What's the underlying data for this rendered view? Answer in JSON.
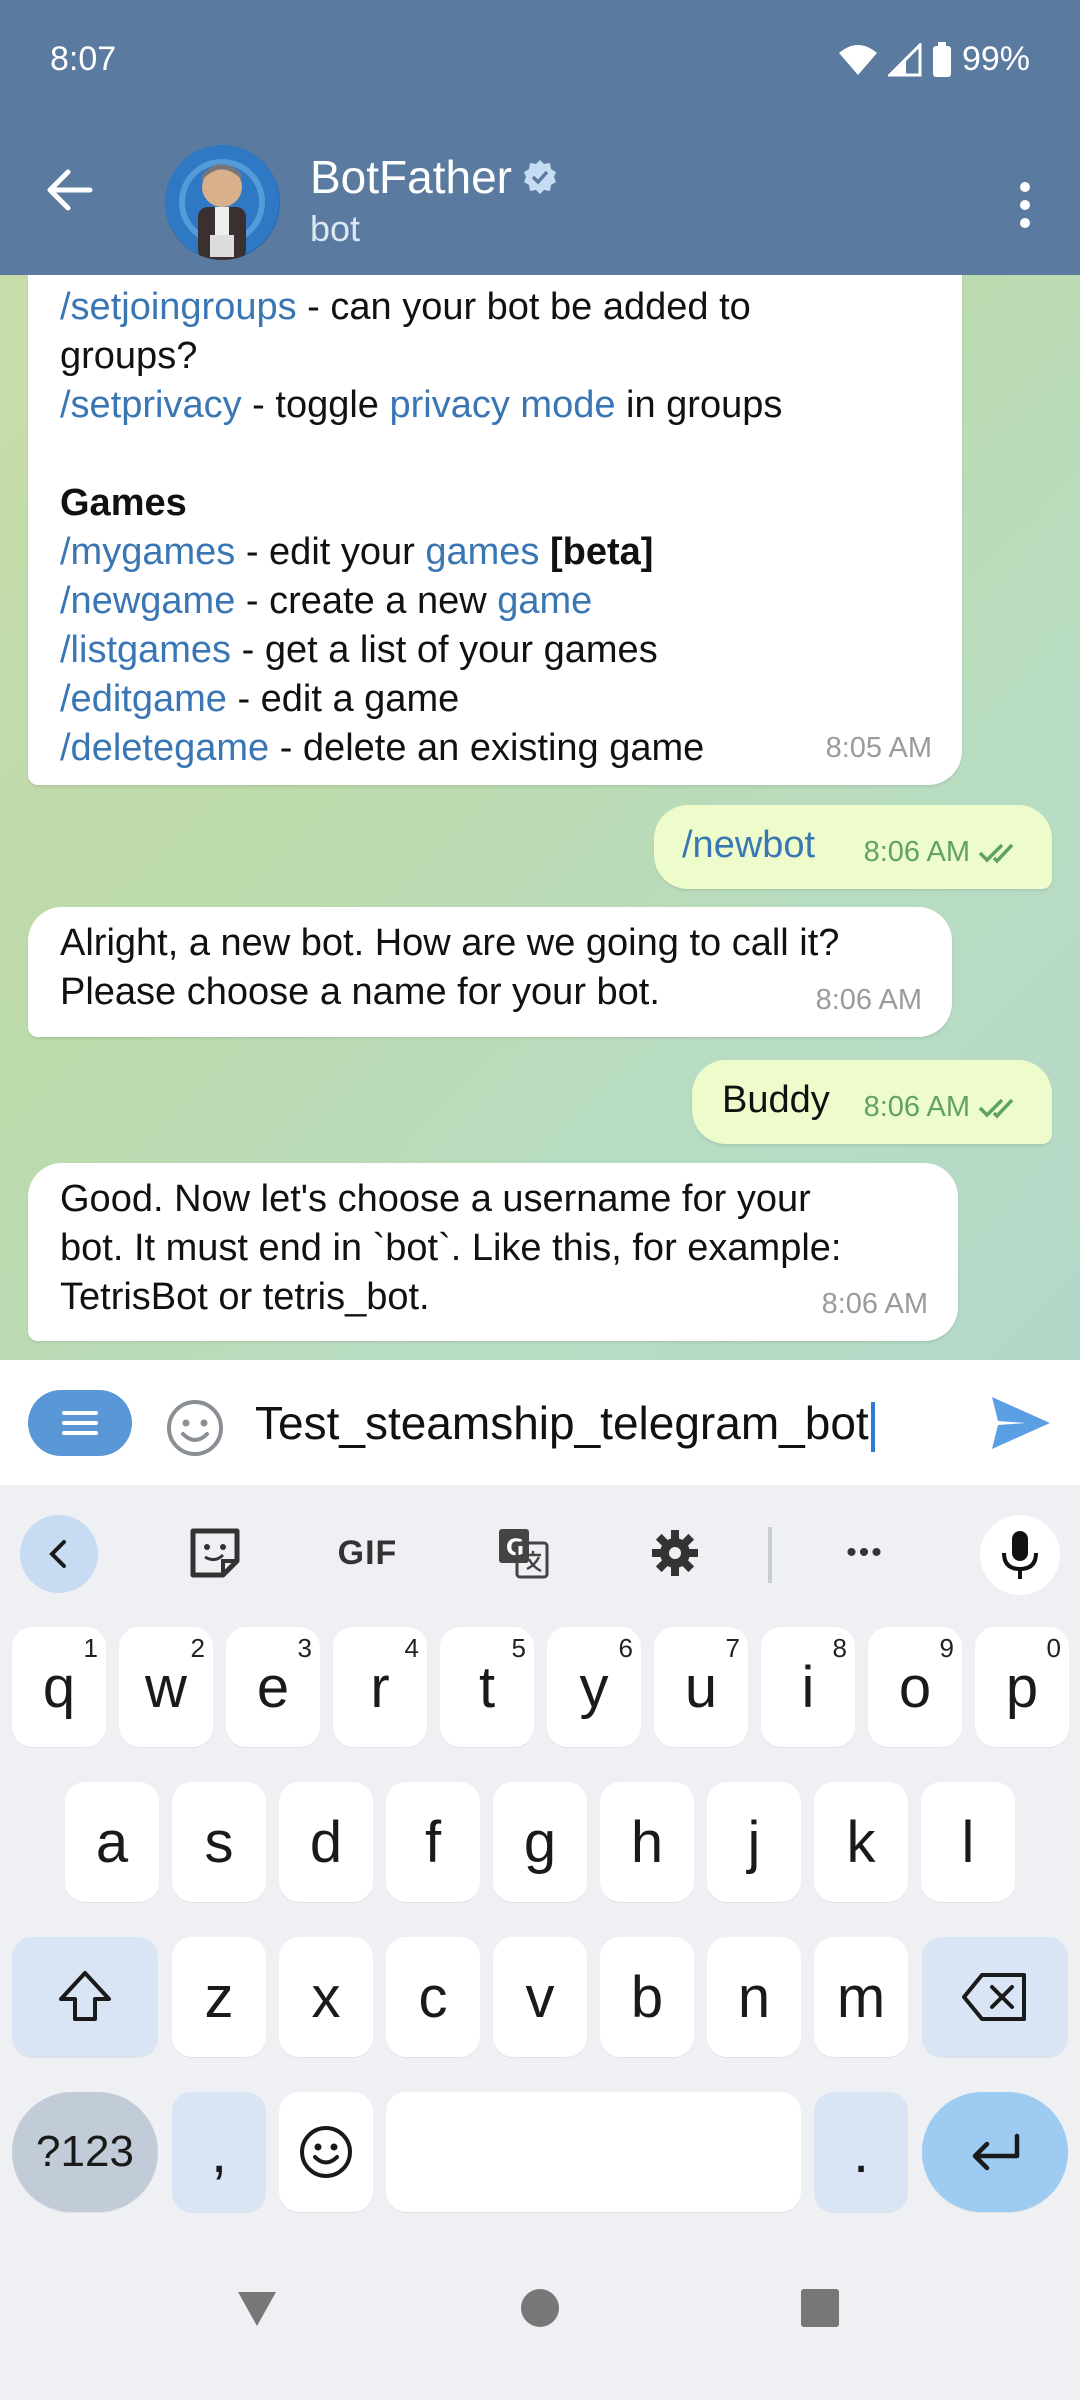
{
  "status": {
    "time": "8:07",
    "battery": "99%"
  },
  "header": {
    "name": "BotFather",
    "subtitle": "bot"
  },
  "messages": {
    "m1": {
      "line1_cmd": "/setjoingroups",
      "line1_text": " - can your bot be added to",
      "line2_text": "groups?",
      "line3_cmd": "/setprivacy",
      "line3_text1": " - toggle ",
      "line3_link": "privacy mode",
      "line3_text2": " in groups",
      "games_heading": "Games",
      "g1_cmd": "/mygames",
      "g1_text": " - edit your ",
      "g1_link": "games",
      "g1_beta": "[beta]",
      "g2_cmd": "/newgame",
      "g2_text": " - create a new ",
      "g2_link": "game",
      "g3_cmd": "/listgames",
      "g3_text": " - get a list of your games",
      "g4_cmd": "/editgame",
      "g4_text": " - edit a game",
      "g5_cmd": "/deletegame",
      "g5_text": " - delete an existing game",
      "time": "8:05 AM"
    },
    "m2": {
      "text": "/newbot",
      "time": "8:06 AM"
    },
    "m3": {
      "line1": "Alright, a new bot. How are we going to call it?",
      "line2": "Please choose a name for your bot.",
      "time": "8:06 AM"
    },
    "m4": {
      "text": "Buddy",
      "time": "8:06 AM"
    },
    "m5": {
      "line1": "Good. Now let's choose a username for your",
      "line2": "bot. It must end in `bot`. Like this, for example:",
      "line3": "TetrisBot or tetris_bot.",
      "time": "8:06 AM"
    }
  },
  "input": {
    "value": "Test_steamship_telegram_bot"
  },
  "keyboard": {
    "toolbar": {
      "gif": "GIF",
      "more": "•••"
    },
    "row1": [
      {
        "k": "q",
        "n": "1"
      },
      {
        "k": "w",
        "n": "2"
      },
      {
        "k": "e",
        "n": "3"
      },
      {
        "k": "r",
        "n": "4"
      },
      {
        "k": "t",
        "n": "5"
      },
      {
        "k": "y",
        "n": "6"
      },
      {
        "k": "u",
        "n": "7"
      },
      {
        "k": "i",
        "n": "8"
      },
      {
        "k": "o",
        "n": "9"
      },
      {
        "k": "p",
        "n": "0"
      }
    ],
    "row2": [
      "a",
      "s",
      "d",
      "f",
      "g",
      "h",
      "j",
      "k",
      "l"
    ],
    "row3": [
      "z",
      "x",
      "c",
      "v",
      "b",
      "n",
      "m"
    ],
    "sym": "?123",
    "comma": ",",
    "period": "."
  },
  "colors": {
    "header": "#5a7aa0",
    "accent": "#3a76b4",
    "outgoing": "#eefccc",
    "check": "#5fa35f"
  }
}
